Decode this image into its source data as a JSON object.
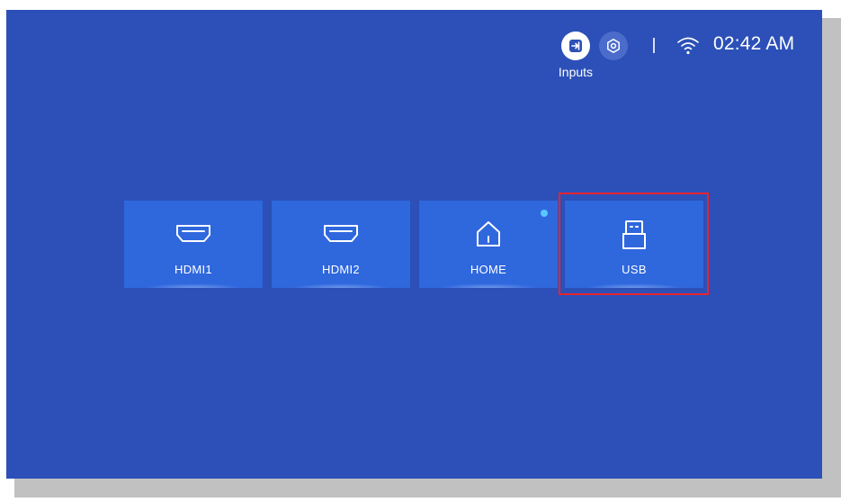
{
  "status_bar": {
    "inputs_label": "Inputs",
    "time": "02:42 AM",
    "icons": [
      "input-source-icon",
      "settings-icon",
      "wifi-icon"
    ]
  },
  "inputs": [
    {
      "label": "HDMI1",
      "icon": "hdmi-icon",
      "selected": false,
      "notification": false
    },
    {
      "label": "HDMI2",
      "icon": "hdmi-icon",
      "selected": false,
      "notification": false
    },
    {
      "label": "HOME",
      "icon": "home-icon",
      "selected": false,
      "notification": true
    },
    {
      "label": "USB",
      "icon": "usb-icon",
      "selected": true,
      "notification": false
    }
  ],
  "colors": {
    "background": "#2c50b7",
    "tile": "#2f67dd",
    "focus_outline": "#e8232f",
    "notification_dot": "#59c7ff"
  }
}
